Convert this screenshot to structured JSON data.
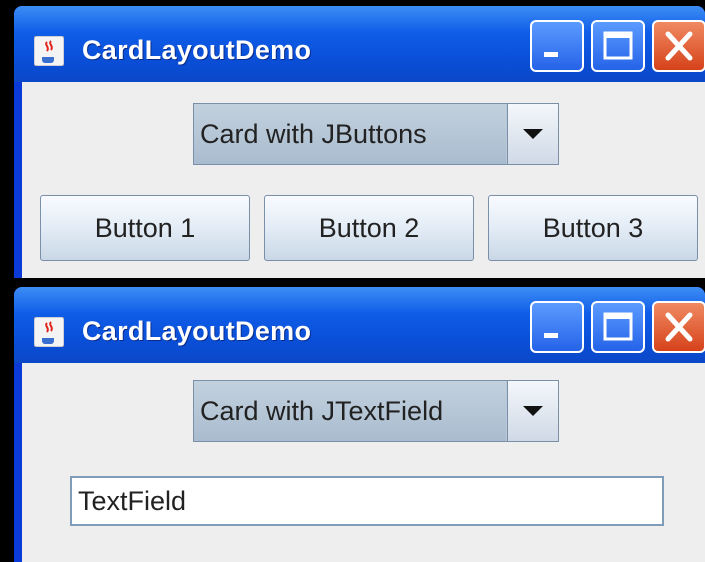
{
  "windows": [
    {
      "title": "CardLayoutDemo",
      "combo": {
        "selected": "Card with JButtons"
      },
      "buttons": [
        "Button 1",
        "Button 2",
        "Button 3"
      ]
    },
    {
      "title": "CardLayoutDemo",
      "combo": {
        "selected": "Card with JTextField"
      },
      "textfield": {
        "value": "TextField"
      }
    }
  ],
  "icons": {
    "app": "java-coffee-cup-icon",
    "minimize": "minimize-icon",
    "maximize": "maximize-icon",
    "close": "close-icon",
    "dropdown": "chevron-down-icon"
  },
  "colors": {
    "titlebar": "#0b4fd8",
    "close_button": "#d6421a",
    "client_background": "#eeeeee",
    "text_field_border": "#7f9db9"
  }
}
